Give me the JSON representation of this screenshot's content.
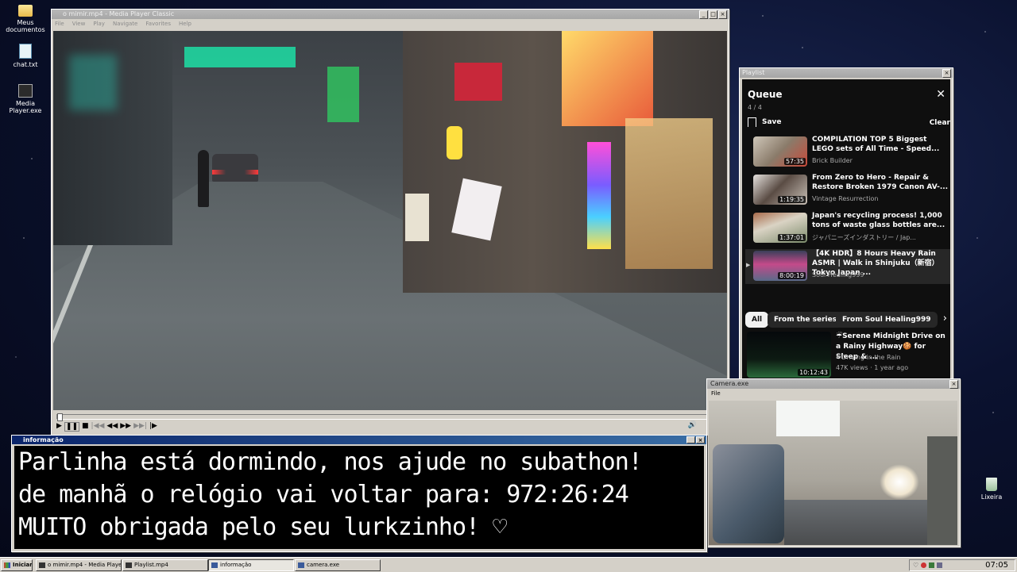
{
  "desktop": {
    "icons": [
      {
        "label": "Meus documentos"
      },
      {
        "label": "chat.txt"
      },
      {
        "label": "Media Player.exe"
      },
      {
        "label": "Lixeira"
      }
    ]
  },
  "player": {
    "title": "o mimir.mp4 - Media Player Classic",
    "menu": [
      "File",
      "View",
      "Play",
      "Navigate",
      "Favorites",
      "Help"
    ],
    "progress": 0.005
  },
  "playlist": {
    "window_title": "Playlist",
    "heading": "Queue",
    "position": "4 / 4",
    "save_label": "Save",
    "clear_label": "Clear",
    "items": [
      {
        "title": "COMPILATION TOP 5 Biggest LEGO sets of All Time - Speed...",
        "channel": "Brick Builder",
        "duration": "57:35"
      },
      {
        "title": "From Zero to Hero - Repair & Restore Broken 1979 Canon AV-...",
        "channel": "Vintage Resurrection",
        "duration": "1:19:35"
      },
      {
        "title": "Japan's recycling process! 1,000 tons of waste glass bottles are...",
        "channel": "ジャパニーズインダストリー / Jap...",
        "duration": "1:37:01"
      },
      {
        "title": "【4K HDR】8 Hours Heavy Rain ASMR | Walk in Shinjuku（新宿）Tokyo Japan ...",
        "channel": "Soul Healing999",
        "duration": "8:00:19"
      }
    ],
    "chips": [
      "All",
      "From the series",
      "From Soul Healing999"
    ],
    "recommended": {
      "title": "☔Serene Midnight Drive on a Rainy Highway🍪 for Sleep & ...",
      "channel": "☔Driving in the Rain",
      "meta": "47K views · 1 year ago",
      "duration": "10:12:43"
    }
  },
  "camera": {
    "title": "Camera.exe",
    "menu": "File"
  },
  "info": {
    "title": "informação",
    "lines": [
      "Parlinha está dormindo, nos ajude no subathon!",
      "de manhã o relógio vai voltar para:  972:26:24",
      "MUITO obrigada pelo seu lurkzinho! ♡"
    ]
  },
  "taskbar": {
    "start": "Iniciar",
    "buttons": [
      "o mimir.mp4 - Media Playe...",
      "Playlist.mp4",
      "informação",
      "camera.exe"
    ],
    "clock": "07:05"
  }
}
